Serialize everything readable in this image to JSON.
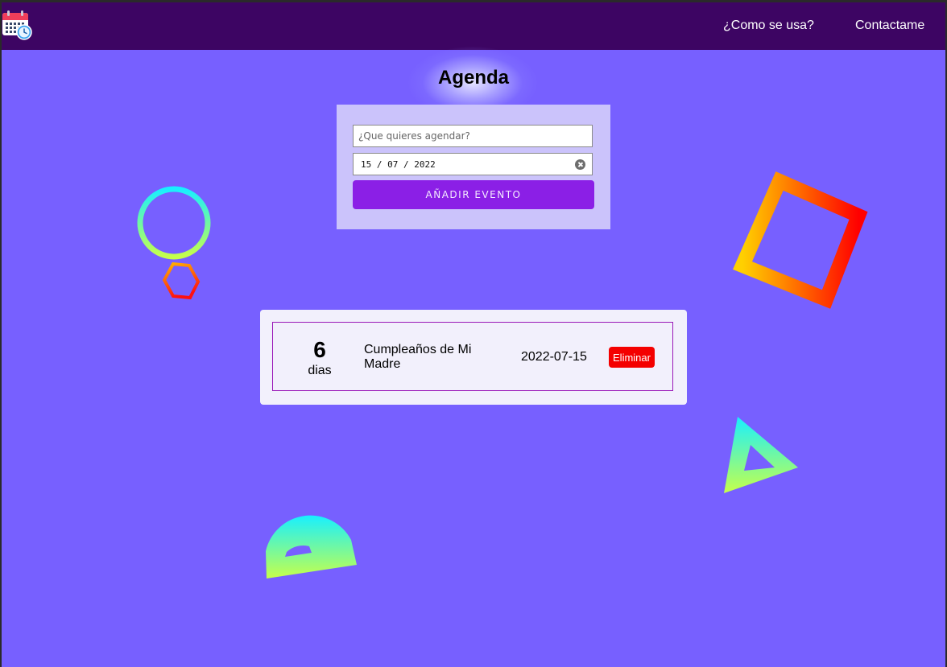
{
  "navbar": {
    "logo_icon": "calendar-clock-icon",
    "links": [
      "¿Como se usa?",
      "Contactame"
    ]
  },
  "page": {
    "title": "Agenda"
  },
  "form": {
    "text_placeholder": "¿Que quieres agendar?",
    "date_value": "15 / 07 / 2022",
    "clear_icon": "clear-circle-icon",
    "submit_label": "AÑADIR EVENTO"
  },
  "events": [
    {
      "days_remaining": "6",
      "days_label": "dias",
      "name": "Cumpleaños de Mi Madre",
      "date": "2022-07-15",
      "delete_label": "Eliminar"
    }
  ],
  "colors": {
    "background": "#7760ff",
    "navbar": "#3d0563",
    "form_panel": "#cbc3fb",
    "submit_button": "#8b1fe6",
    "delete_button": "#f40000",
    "event_border": "#9a18b8"
  },
  "decorations": [
    "ring-shape",
    "hexagon-shape",
    "square-shape",
    "triangle-shape",
    "semicircle-shape"
  ]
}
